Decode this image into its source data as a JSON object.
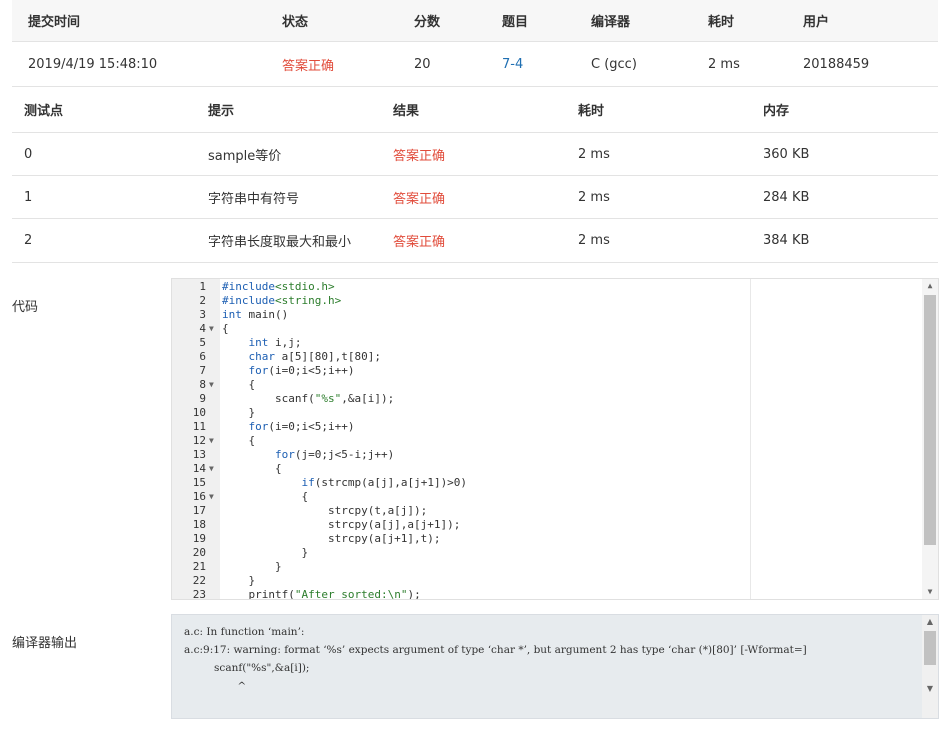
{
  "submission": {
    "headers": [
      "提交时间",
      "状态",
      "分数",
      "题目",
      "编译器",
      "耗时",
      "用户"
    ],
    "row": {
      "time": "2019/4/19 15:48:10",
      "status": "答案正确",
      "score": "20",
      "problem": "7-4",
      "compiler": "C (gcc)",
      "elapsed": "2 ms",
      "user": "20188459"
    }
  },
  "tests": {
    "headers": [
      "测试点",
      "提示",
      "结果",
      "耗时",
      "内存"
    ],
    "rows": [
      {
        "id": "0",
        "hint": "sample等价",
        "result": "答案正确",
        "time": "2 ms",
        "memory": "360 KB"
      },
      {
        "id": "1",
        "hint": "字符串中有符号",
        "result": "答案正确",
        "time": "2 ms",
        "memory": "284 KB"
      },
      {
        "id": "2",
        "hint": "字符串长度取最大和最小",
        "result": "答案正确",
        "time": "2 ms",
        "memory": "384 KB"
      }
    ]
  },
  "code_label": "代码",
  "code_lines": [
    {
      "n": "1",
      "fold": "",
      "t": "#include<stdio.h>"
    },
    {
      "n": "2",
      "fold": "",
      "t": "#include<string.h>"
    },
    {
      "n": "3",
      "fold": "",
      "t": "int main()"
    },
    {
      "n": "4",
      "fold": "▼",
      "t": "{"
    },
    {
      "n": "5",
      "fold": "",
      "t": "    int i,j;"
    },
    {
      "n": "6",
      "fold": "",
      "t": "    char a[5][80],t[80];"
    },
    {
      "n": "7",
      "fold": "",
      "t": "    for(i=0;i<5;i++)"
    },
    {
      "n": "8",
      "fold": "▼",
      "t": "    {"
    },
    {
      "n": "9",
      "fold": "",
      "t": "        scanf(\"%s\",&a[i]);"
    },
    {
      "n": "10",
      "fold": "",
      "t": "    }"
    },
    {
      "n": "11",
      "fold": "",
      "t": "    for(i=0;i<5;i++)"
    },
    {
      "n": "12",
      "fold": "▼",
      "t": "    {"
    },
    {
      "n": "13",
      "fold": "",
      "t": "        for(j=0;j<5-i;j++)"
    },
    {
      "n": "14",
      "fold": "▼",
      "t": "        {"
    },
    {
      "n": "15",
      "fold": "",
      "t": "            if(strcmp(a[j],a[j+1])>0)"
    },
    {
      "n": "16",
      "fold": "▼",
      "t": "            {"
    },
    {
      "n": "17",
      "fold": "",
      "t": "                strcpy(t,a[j]);"
    },
    {
      "n": "18",
      "fold": "",
      "t": "                strcpy(a[j],a[j+1]);"
    },
    {
      "n": "19",
      "fold": "",
      "t": "                strcpy(a[j+1],t);"
    },
    {
      "n": "20",
      "fold": "",
      "t": "            }"
    },
    {
      "n": "21",
      "fold": "",
      "t": "        }"
    },
    {
      "n": "22",
      "fold": "",
      "t": "    }"
    },
    {
      "n": "23",
      "fold": "",
      "t": "    printf(\"After sorted:\\n\");"
    }
  ],
  "compiler_output_label": "编译器输出",
  "compiler_output": "a.c: In function ‘main’:\na.c:9:17: warning: format ‘%s’ expects argument of type ‘char *’, but argument 2 has type ‘char (*)[80]’ [-Wformat=]\n         scanf(\"%s\",&a[i]);\n                ^",
  "colors": {
    "success": "#e14c3b",
    "link": "#1f6fb2",
    "keyword": "#1d5fb3",
    "string": "#2c7d2c"
  }
}
